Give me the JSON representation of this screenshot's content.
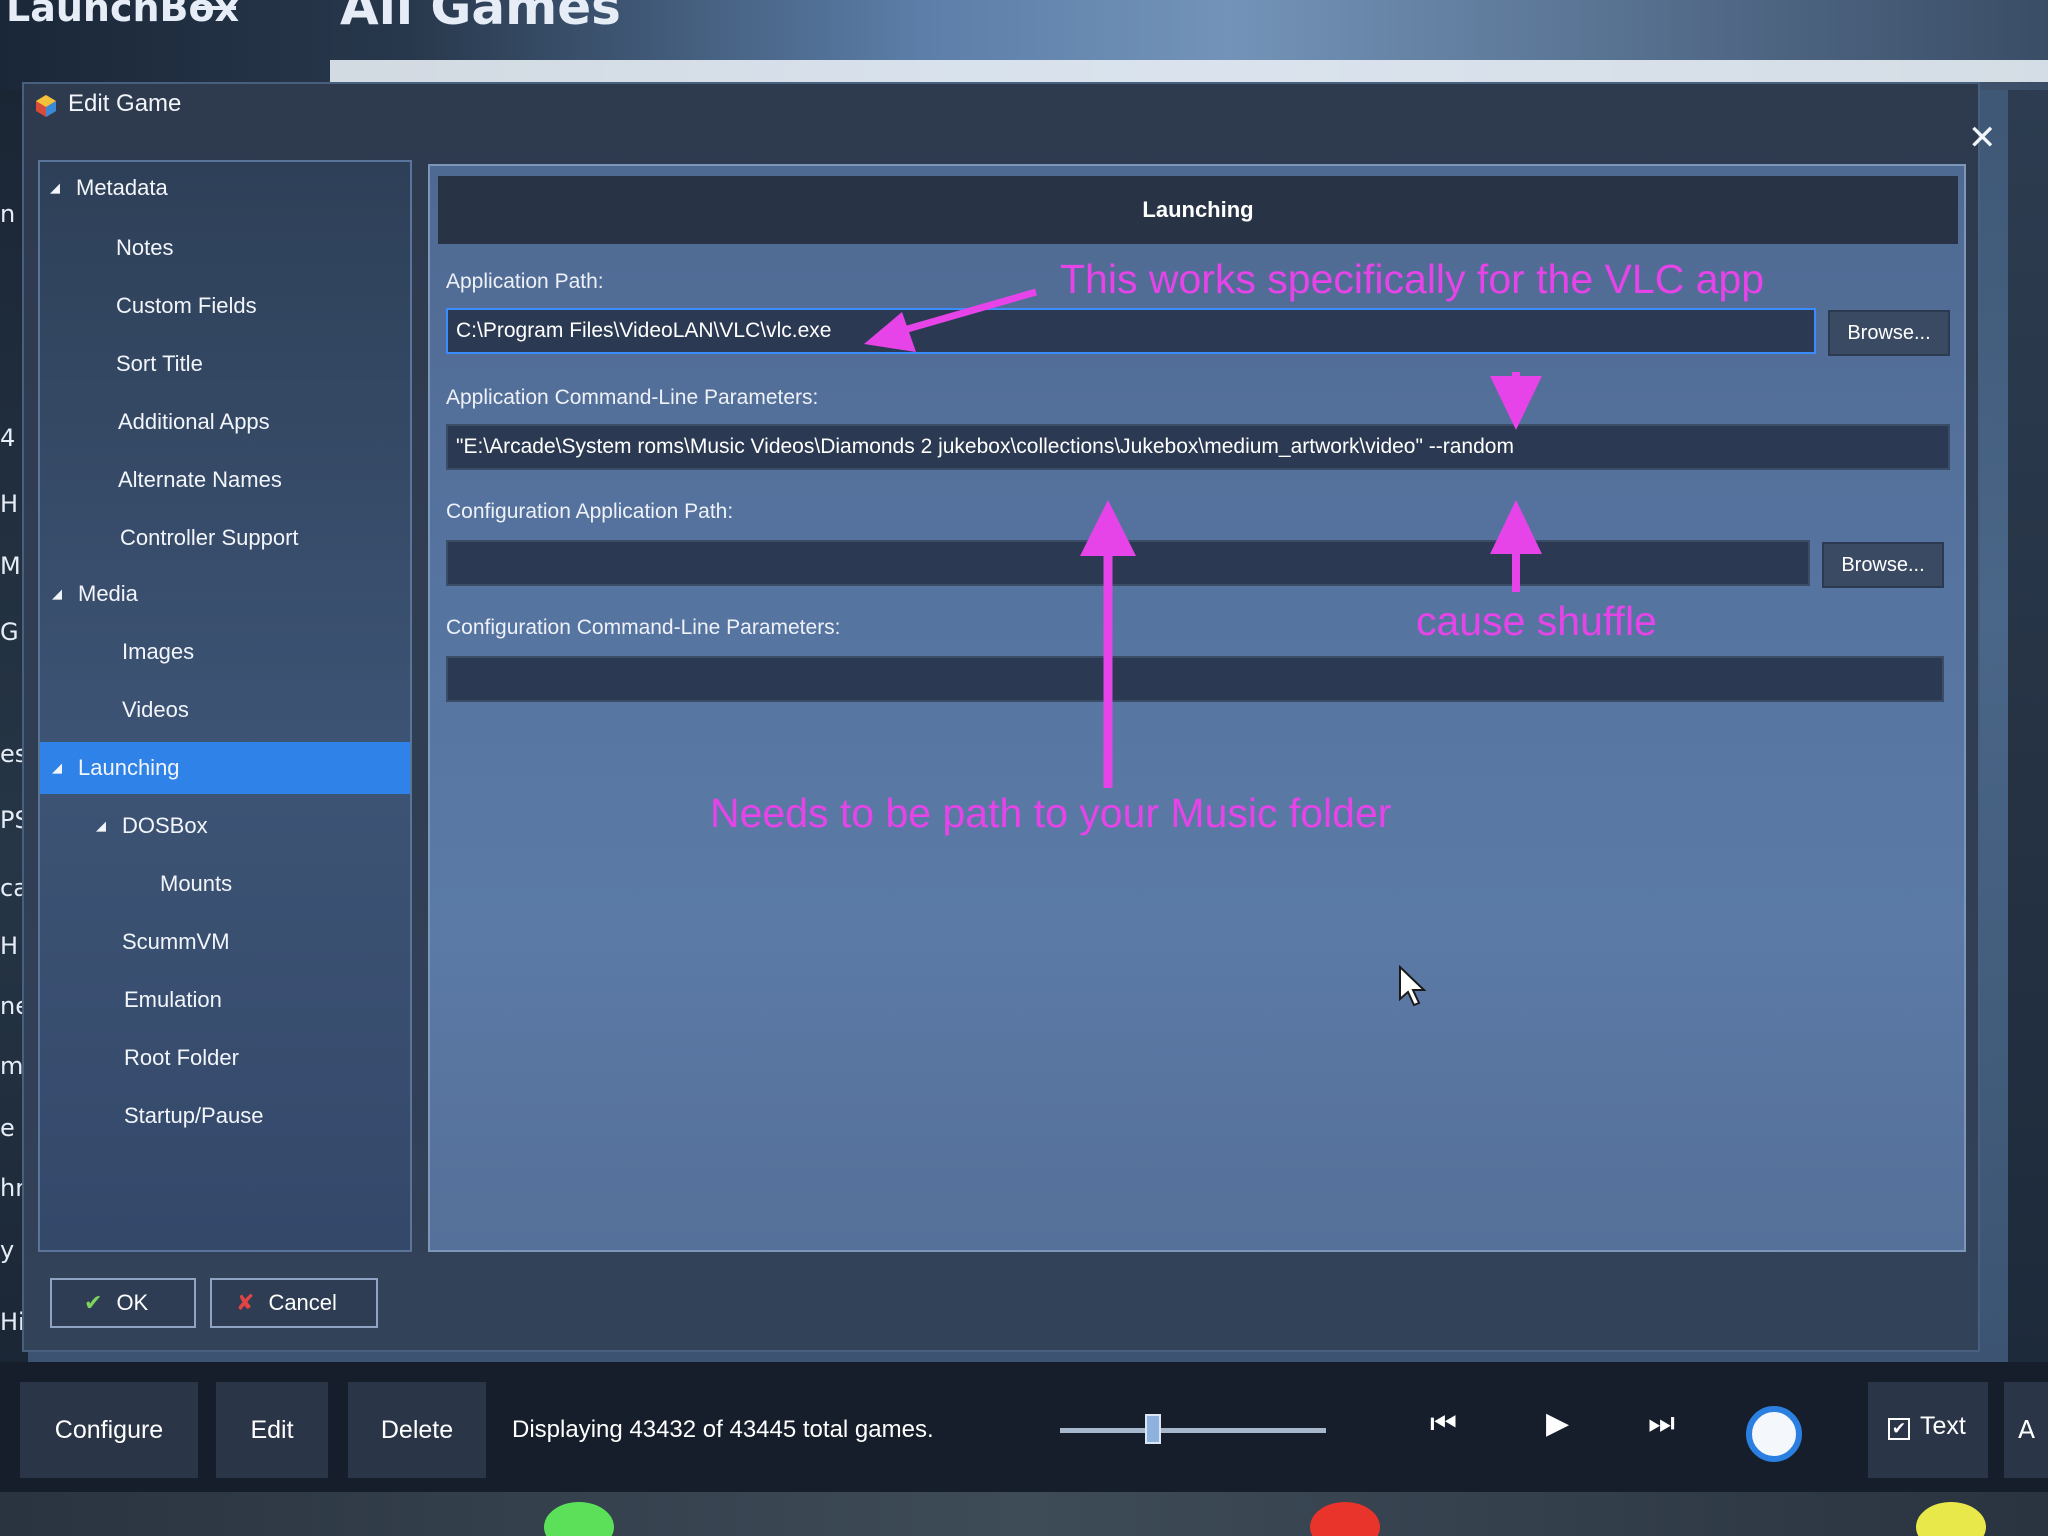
{
  "background": {
    "app_name": "LaunchBox",
    "heading": "All Games",
    "left_list_fragments": [
      "n",
      "4",
      "H",
      "M",
      "G",
      "es",
      "PS",
      "ca",
      "H",
      "ne",
      "m",
      "e -",
      "hn",
      "y",
      "Hi"
    ]
  },
  "dialog": {
    "title": "Edit Game",
    "close_glyph": "✕",
    "nav": [
      {
        "label": "Metadata",
        "arrow": "◢"
      },
      {
        "label": "Notes"
      },
      {
        "label": "Custom Fields"
      },
      {
        "label": "Sort Title"
      },
      {
        "label": "Additional Apps"
      },
      {
        "label": "Alternate Names"
      },
      {
        "label": "Controller Support"
      },
      {
        "label": "Media",
        "arrow": "◢"
      },
      {
        "label": "Images"
      },
      {
        "label": "Videos"
      },
      {
        "label": "Launching",
        "arrow": "◢",
        "selected": true
      },
      {
        "label": "DOSBox",
        "arrow": "◢"
      },
      {
        "label": "Mounts"
      },
      {
        "label": "ScummVM"
      },
      {
        "label": "Emulation"
      },
      {
        "label": "Root Folder"
      },
      {
        "label": "Startup/Pause"
      }
    ],
    "main": {
      "header": "Launching",
      "app_path_label": "Application Path:",
      "app_path_value": "C:\\Program Files\\VideoLAN\\VLC\\vlc.exe",
      "browse_label": "Browse...",
      "cmdline_label": "Application Command-Line Parameters:",
      "cmdline_value": "\"E:\\Arcade\\System roms\\Music Videos\\Diamonds 2 jukebox\\collections\\Jukebox\\medium_artwork\\video\" --random",
      "config_path_label": "Configuration Application Path:",
      "config_path_value": "",
      "config_browse_label": "Browse...",
      "config_cmdline_label": "Configuration Command-Line Parameters:",
      "config_cmdline_value": ""
    },
    "annotations": {
      "vlc_note": "This works specifically for the VLC app",
      "shuffle_note": "cause shuffle",
      "music_note": "Needs to be path to your Music folder",
      "color": "#e644e8"
    },
    "ok_label": "OK",
    "ok_glyph": "✔",
    "cancel_label": "Cancel",
    "cancel_glyph": "✘"
  },
  "toolbar": {
    "configure_label": "Configure",
    "edit_label": "Edit",
    "delete_label": "Delete",
    "status": "Displaying 43432 of 43445 total games.",
    "slider_level": 0.35,
    "prev_glyph": "⏮",
    "play_glyph": "▶",
    "next_glyph": "⏭",
    "text_toggle_label": "Text",
    "text_toggle_checked": "✔",
    "cut_label": "A"
  },
  "colors": {
    "selection": "#2f82e8",
    "annotation": "#e644e8",
    "focus": "#3b8cff"
  }
}
